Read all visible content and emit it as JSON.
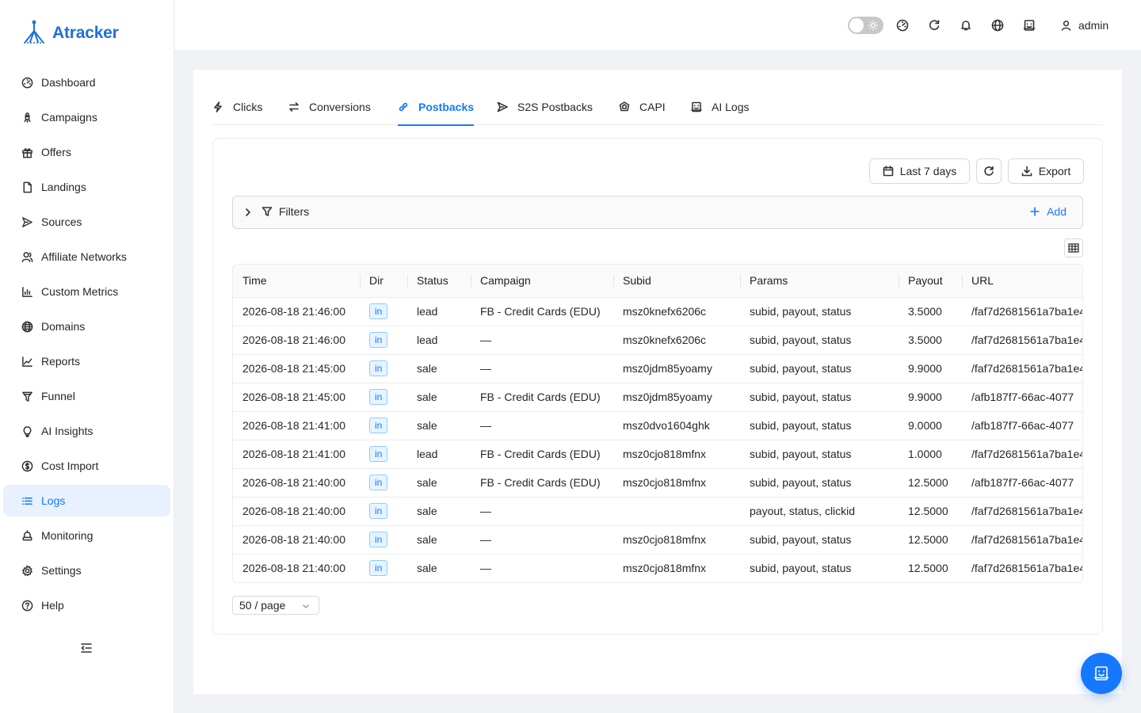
{
  "app": {
    "name": "Atracker"
  },
  "sidebar": {
    "items": [
      {
        "label": "Dashboard",
        "icon": "dashboard-icon"
      },
      {
        "label": "Campaigns",
        "icon": "rocket-icon"
      },
      {
        "label": "Offers",
        "icon": "gift-icon"
      },
      {
        "label": "Landings",
        "icon": "file-icon"
      },
      {
        "label": "Sources",
        "icon": "send-icon"
      },
      {
        "label": "Affiliate Networks",
        "icon": "users-icon"
      },
      {
        "label": "Custom Metrics",
        "icon": "bar-chart-icon"
      },
      {
        "label": "Domains",
        "icon": "globe-icon"
      },
      {
        "label": "Reports",
        "icon": "line-chart-icon"
      },
      {
        "label": "Funnel",
        "icon": "funnel-icon"
      },
      {
        "label": "AI Insights",
        "icon": "bulb-icon"
      },
      {
        "label": "Cost Import",
        "icon": "dollar-icon"
      },
      {
        "label": "Logs",
        "icon": "list-icon",
        "active": true
      },
      {
        "label": "Monitoring",
        "icon": "monitor-icon"
      },
      {
        "label": "Settings",
        "icon": "gear-icon"
      },
      {
        "label": "Help",
        "icon": "help-icon"
      }
    ]
  },
  "header": {
    "user": "admin"
  },
  "tabs": [
    {
      "label": "Clicks",
      "icon": "bolt-icon"
    },
    {
      "label": "Conversions",
      "icon": "swap-icon"
    },
    {
      "label": "Postbacks",
      "icon": "link-icon",
      "active": true
    },
    {
      "label": "S2S Postbacks",
      "icon": "send-icon"
    },
    {
      "label": "CAPI",
      "icon": "api-icon"
    },
    {
      "label": "AI Logs",
      "icon": "robot-icon"
    }
  ],
  "toolbar": {
    "date_range": "Last 7 days",
    "export": "Export"
  },
  "filters": {
    "label": "Filters",
    "add": "Add"
  },
  "table": {
    "columns": [
      "Time",
      "Dir",
      "Status",
      "Campaign",
      "Subid",
      "Params",
      "Payout",
      "URL"
    ],
    "rows": [
      [
        "2026-08-18 21:46:00",
        "in",
        "lead",
        "FB - Credit Cards (EDU)",
        "msz0knefx6206c",
        "subid, payout, status",
        "3.5000",
        "/faf7d2681561a7ba1e4"
      ],
      [
        "2026-08-18 21:46:00",
        "in",
        "lead",
        "—",
        "msz0knefx6206c",
        "subid, payout, status",
        "3.5000",
        "/faf7d2681561a7ba1e4"
      ],
      [
        "2026-08-18 21:45:00",
        "in",
        "sale",
        "—",
        "msz0jdm85yoamy",
        "subid, payout, status",
        "9.9000",
        "/faf7d2681561a7ba1e4"
      ],
      [
        "2026-08-18 21:45:00",
        "in",
        "sale",
        "FB - Credit Cards (EDU)",
        "msz0jdm85yoamy",
        "subid, payout, status",
        "9.9000",
        "/afb187f7-66ac-4077"
      ],
      [
        "2026-08-18 21:41:00",
        "in",
        "sale",
        "—",
        "msz0dvo1604ghk",
        "subid, payout, status",
        "9.0000",
        "/afb187f7-66ac-4077"
      ],
      [
        "2026-08-18 21:41:00",
        "in",
        "lead",
        "FB - Credit Cards (EDU)",
        "msz0cjo818mfnx",
        "subid, payout, status",
        "1.0000",
        "/faf7d2681561a7ba1e4"
      ],
      [
        "2026-08-18 21:40:00",
        "in",
        "sale",
        "FB - Credit Cards (EDU)",
        "msz0cjo818mfnx",
        "subid, payout, status",
        "12.5000",
        "/afb187f7-66ac-4077"
      ],
      [
        "2026-08-18 21:40:00",
        "in",
        "sale",
        "—",
        "",
        "payout, status, clickid",
        "12.5000",
        "/faf7d2681561a7ba1e4"
      ],
      [
        "2026-08-18 21:40:00",
        "in",
        "sale",
        "—",
        "msz0cjo818mfnx",
        "subid, payout, status",
        "12.5000",
        "/faf7d2681561a7ba1e4"
      ],
      [
        "2026-08-18 21:40:00",
        "in",
        "sale",
        "—",
        "msz0cjo818mfnx",
        "subid, payout, status",
        "12.5000",
        "/faf7d2681561a7ba1e4"
      ]
    ]
  },
  "pagination": {
    "page_size": "50 / page"
  },
  "colors": {
    "accent": "#1677ff",
    "brand": "#1f6fd8",
    "active_bg": "#e8f1fd"
  }
}
